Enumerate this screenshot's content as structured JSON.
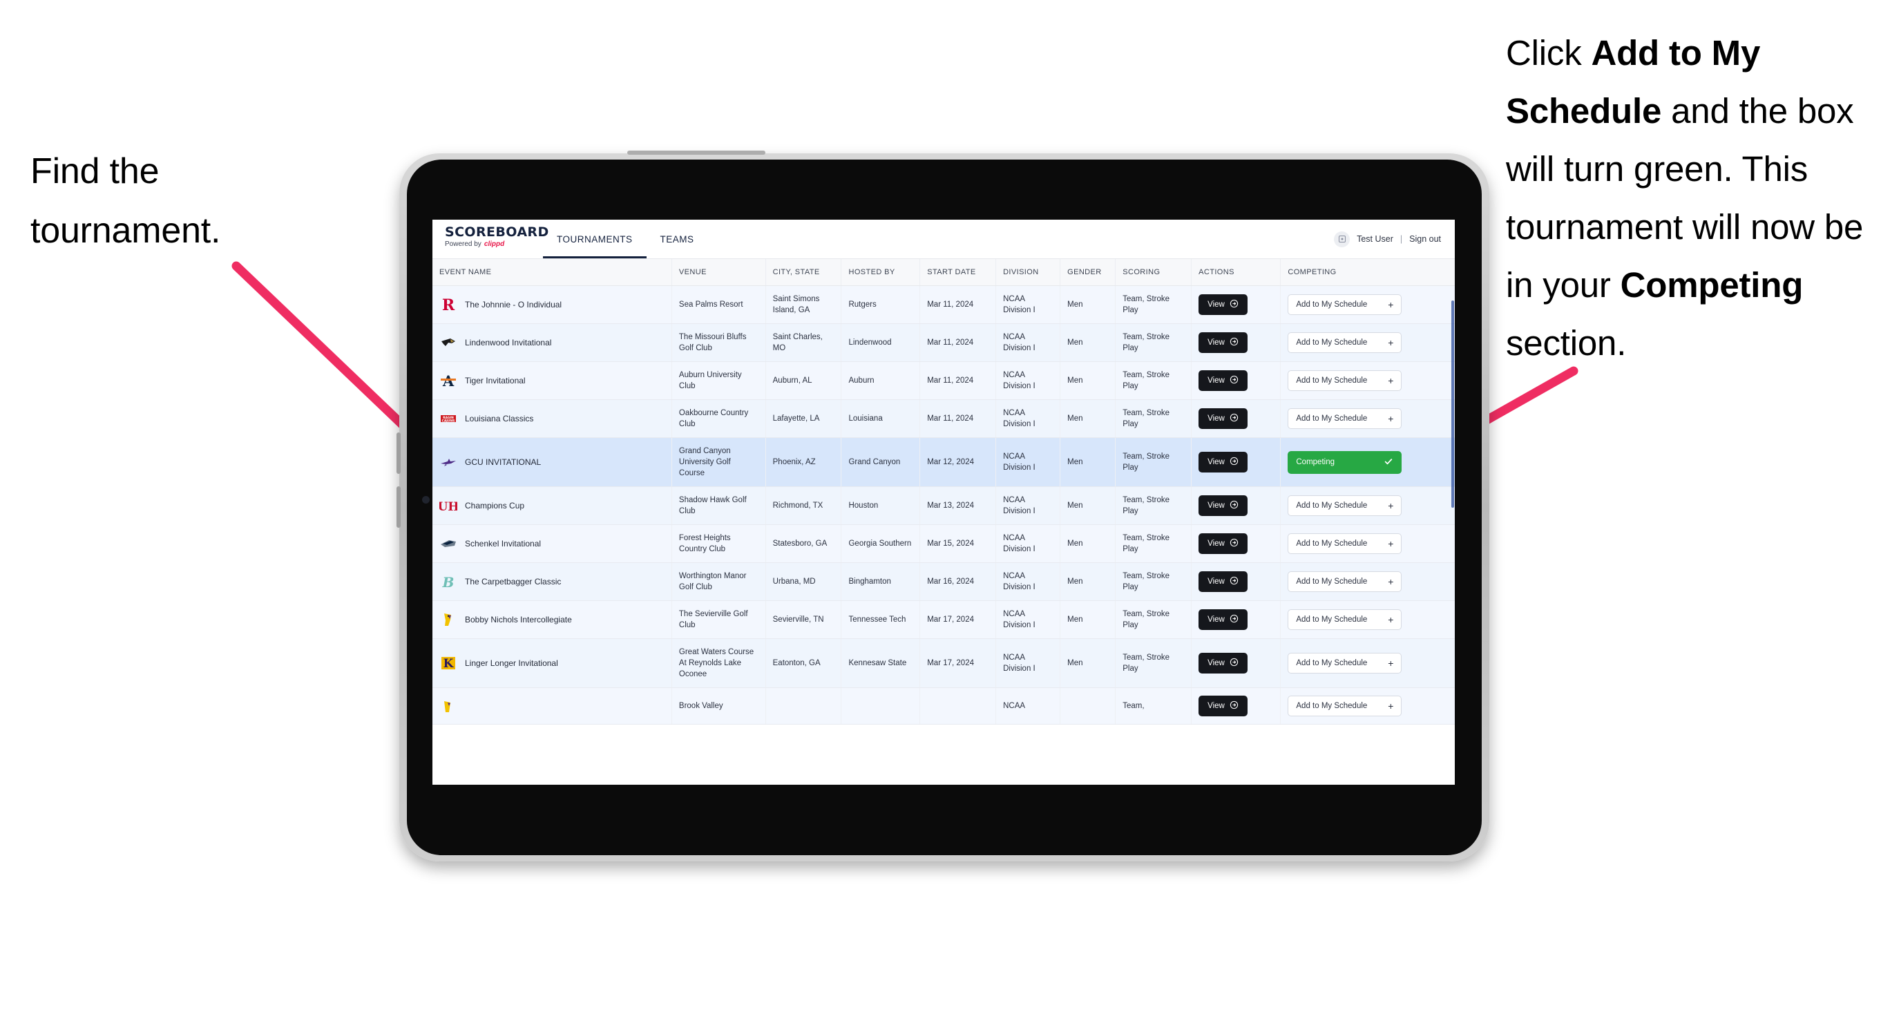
{
  "annotations": {
    "left": "Find the tournament.",
    "right_parts": [
      {
        "text": "Click ",
        "bold": false
      },
      {
        "text": "Add to My Schedule",
        "bold": true
      },
      {
        "text": " and the box will turn green. This tournament will now be in your ",
        "bold": false
      },
      {
        "text": "Competing",
        "bold": true
      },
      {
        "text": " section.",
        "bold": false
      }
    ],
    "arrow_color": "#ef2d62"
  },
  "app": {
    "brand": {
      "title": "SCOREBOARD",
      "powered_prefix": "Powered by",
      "powered_brand": "clippd"
    },
    "tabs": [
      {
        "label": "TOURNAMENTS",
        "active": true
      },
      {
        "label": "TEAMS",
        "active": false
      }
    ],
    "user": {
      "name": "Test User",
      "separator": "|",
      "sign_out": "Sign out",
      "avatar_icon": "user-avatar-icon"
    }
  },
  "table": {
    "columns": [
      "EVENT NAME",
      "VENUE",
      "CITY, STATE",
      "HOSTED BY",
      "START DATE",
      "DIVISION",
      "GENDER",
      "SCORING",
      "ACTIONS",
      "COMPETING"
    ],
    "view_label": "View",
    "add_label": "Add to My Schedule",
    "competing_label": "Competing",
    "rows": [
      {
        "logo": "rutgers-logo",
        "event": "The Johnnie - O Individual",
        "venue": "Sea Palms Resort",
        "city": "Saint Simons Island, GA",
        "host": "Rutgers",
        "date": "Mar 11, 2024",
        "division": "NCAA Division I",
        "gender": "Men",
        "scoring": "Team, Stroke Play",
        "competing": false
      },
      {
        "logo": "lindenwood-logo",
        "event": "Lindenwood Invitational",
        "venue": "The Missouri Bluffs Golf Club",
        "city": "Saint Charles, MO",
        "host": "Lindenwood",
        "date": "Mar 11, 2024",
        "division": "NCAA Division I",
        "gender": "Men",
        "scoring": "Team, Stroke Play",
        "competing": false
      },
      {
        "logo": "auburn-logo",
        "event": "Tiger Invitational",
        "venue": "Auburn University Club",
        "city": "Auburn, AL",
        "host": "Auburn",
        "date": "Mar 11, 2024",
        "division": "NCAA Division I",
        "gender": "Men",
        "scoring": "Team, Stroke Play",
        "competing": false
      },
      {
        "logo": "louisiana-logo",
        "event": "Louisiana Classics",
        "venue": "Oakbourne Country Club",
        "city": "Lafayette, LA",
        "host": "Louisiana",
        "date": "Mar 11, 2024",
        "division": "NCAA Division I",
        "gender": "Men",
        "scoring": "Team, Stroke Play",
        "competing": false
      },
      {
        "logo": "gcu-logo",
        "event": "GCU INVITATIONAL",
        "venue": "Grand Canyon University Golf Course",
        "city": "Phoenix, AZ",
        "host": "Grand Canyon",
        "date": "Mar 12, 2024",
        "division": "NCAA Division I",
        "gender": "Men",
        "scoring": "Team, Stroke Play",
        "competing": true
      },
      {
        "logo": "houston-logo",
        "event": "Champions Cup",
        "venue": "Shadow Hawk Golf Club",
        "city": "Richmond, TX",
        "host": "Houston",
        "date": "Mar 13, 2024",
        "division": "NCAA Division I",
        "gender": "Men",
        "scoring": "Team, Stroke Play",
        "competing": false
      },
      {
        "logo": "georgia-southern-logo",
        "event": "Schenkel Invitational",
        "venue": "Forest Heights Country Club",
        "city": "Statesboro, GA",
        "host": "Georgia Southern",
        "date": "Mar 15, 2024",
        "division": "NCAA Division I",
        "gender": "Men",
        "scoring": "Team, Stroke Play",
        "competing": false
      },
      {
        "logo": "binghamton-logo",
        "event": "The Carpetbagger Classic",
        "venue": "Worthington Manor Golf Club",
        "city": "Urbana, MD",
        "host": "Binghamton",
        "date": "Mar 16, 2024",
        "division": "NCAA Division I",
        "gender": "Men",
        "scoring": "Team, Stroke Play",
        "competing": false
      },
      {
        "logo": "tennessee-tech-logo",
        "event": "Bobby Nichols Intercollegiate",
        "venue": "The Sevierville Golf Club",
        "city": "Sevierville, TN",
        "host": "Tennessee Tech",
        "date": "Mar 17, 2024",
        "division": "NCAA Division I",
        "gender": "Men",
        "scoring": "Team, Stroke Play",
        "competing": false
      },
      {
        "logo": "kennesaw-state-logo",
        "event": "Linger Longer Invitational",
        "venue": "Great Waters Course At Reynolds Lake Oconee",
        "city": "Eatonton, GA",
        "host": "Kennesaw State",
        "date": "Mar 17, 2024",
        "division": "NCAA Division I",
        "gender": "Men",
        "scoring": "Team, Stroke Play",
        "competing": false
      },
      {
        "logo": "partial-logo",
        "event": "",
        "venue": "Brook Valley",
        "city": "",
        "host": "",
        "date": "",
        "division": "NCAA",
        "gender": "",
        "scoring": "Team,",
        "competing": false
      }
    ]
  }
}
